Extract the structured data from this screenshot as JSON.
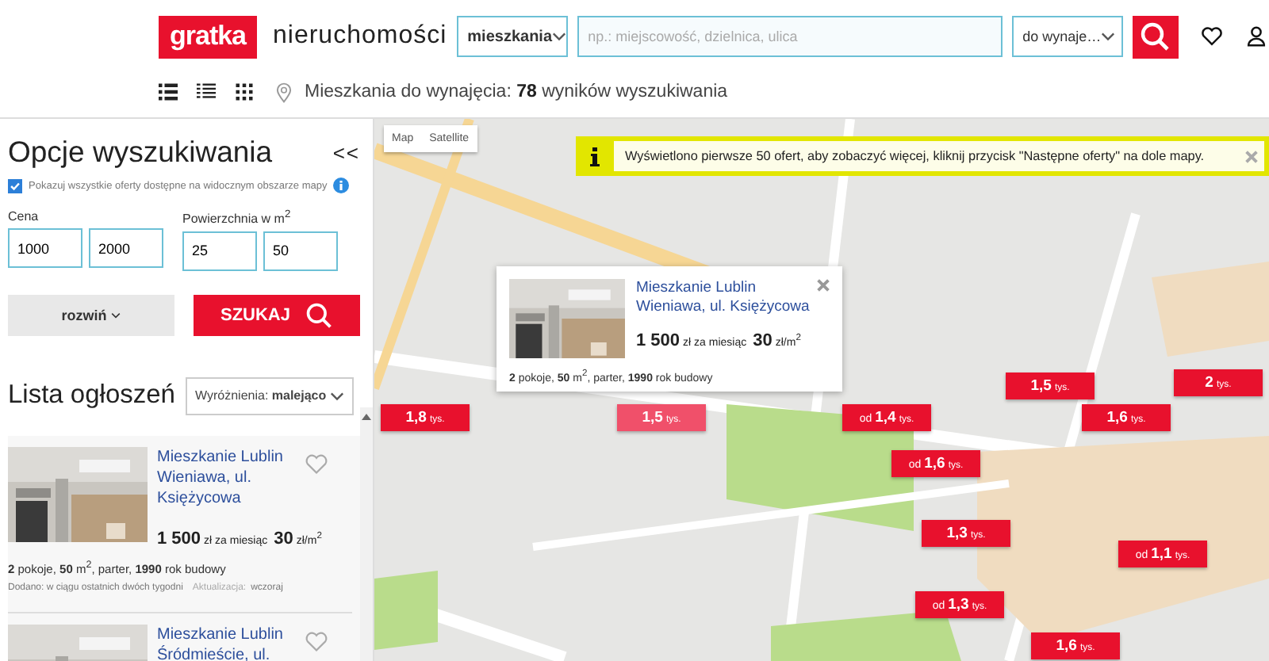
{
  "header": {
    "logo": "gratka",
    "section": "nieruchomości",
    "category": "mieszkania",
    "search_placeholder": "np.: miejscowość, dzielnica, ulica",
    "deal": "do wynaje…"
  },
  "view_modes": [
    {
      "kind": "list"
    },
    {
      "kind": "compact"
    },
    {
      "kind": "grid"
    }
  ],
  "results": "Mieszkania do wynajęcia: **78** wyników wyszukiwania",
  "sidebar": {
    "title": "Opcje wyszukiwania",
    "collapse": "<<",
    "show_all": {
      "label": "Pokazuj wszystkie oferty dostępne na widocznym obszarze mapy",
      "checked": true
    },
    "filters": [
      {
        "label": "Cena",
        "from": "1000",
        "to": "2000"
      },
      {
        "label": "Powierzchnia w m$^{2}$",
        "from": "25",
        "to": "50"
      }
    ],
    "expand_button": "rozwiń",
    "search_button": "SZUKAJ",
    "list_title": "Lista ogłoszeń",
    "sort": "Wyróżnienia: **malejąco**"
  },
  "listings": [
    {
      "title": "Mieszkanie Lublin Wieniawa, ul. Księżycowa",
      "price": "1 500",
      "price_unit": "zł za miesiąc",
      "price_per_m": "30",
      "per_m_unit": "zł/m$^{2}$",
      "details": "**2** pokoje, **50** m$^{2}$, parter, **1990** rok budowy",
      "added": "Dodano: w ciągu ostatnich dwóch tygodni",
      "updated_label": "Aktualizacja:",
      "updated": "wczoraj"
    },
    {
      "title": "Mieszkanie Lublin Śródmieście, ul."
    }
  ],
  "map": {
    "types": [
      "Map",
      "Satellite"
    ],
    "notice": "Wyświetlono pierwsze 50 ofert, aby zobaczyć więcej, kliknij przycisk \"Następne oferty\" na dole mapy.",
    "popup": {
      "title": "Mieszkanie Lublin Wieniawa, ul. Księżycowa",
      "price": "1 500",
      "price_unit": "zł za miesiąc",
      "price_per_m": "30",
      "per_m_unit": "zł/m$^{2}$",
      "details": "**2** pokoje, **50** m$^{2}$, parter, **1990** rok budowy"
    },
    "markers": [
      {
        "value": "1,8",
        "unit": "tys.",
        "highlighted": false
      },
      {
        "value": "1,5",
        "unit": "tys.",
        "highlighted": true
      },
      {
        "prefix": "od",
        "value": "1,4",
        "unit": "tys.",
        "highlighted": false
      },
      {
        "value": "1,5",
        "unit": "tys.",
        "highlighted": false
      },
      {
        "value": "1,6",
        "unit": "tys.",
        "highlighted": false
      },
      {
        "value": "2",
        "unit": "tys.",
        "highlighted": false
      },
      {
        "prefix": "od",
        "value": "1,6",
        "unit": "tys.",
        "highlighted": false
      },
      {
        "value": "1,3",
        "unit": "tys.",
        "highlighted": false
      },
      {
        "prefix": "od",
        "value": "1,1",
        "unit": "tys.",
        "highlighted": false
      },
      {
        "prefix": "od",
        "value": "1,3",
        "unit": "tys.",
        "highlighted": false
      },
      {
        "value": "1,6",
        "unit": "tys.",
        "highlighted": false
      }
    ]
  }
}
